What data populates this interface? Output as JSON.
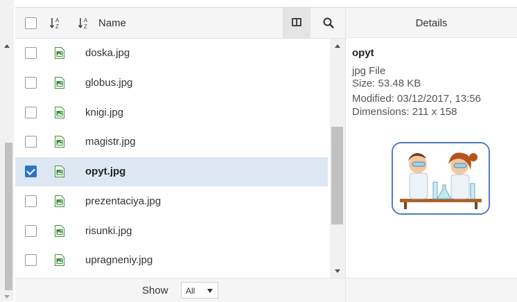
{
  "header": {
    "name_label": "Name",
    "details_label": "Details"
  },
  "files": [
    {
      "name": "doska.jpg",
      "selected": false
    },
    {
      "name": "globus.jpg",
      "selected": false
    },
    {
      "name": "knigi.jpg",
      "selected": false
    },
    {
      "name": "magistr.jpg",
      "selected": false
    },
    {
      "name": "opyt.jpg",
      "selected": true
    },
    {
      "name": "prezentaciya.jpg",
      "selected": false
    },
    {
      "name": "risunki.jpg",
      "selected": false
    },
    {
      "name": "upragneniy.jpg",
      "selected": false
    }
  ],
  "footer": {
    "show_label": "Show",
    "show_value": "All"
  },
  "details": {
    "name": "opyt",
    "type": "jpg File",
    "size": "Size: 53.48 KB",
    "modified": "Modified: 03/12/2017, 13:56",
    "dimensions": "Dimensions: 211 x 158"
  },
  "colors": {
    "selection": "#dde8f4",
    "checkbox_checked": "#2e74c5",
    "preview_border": "#4d79c7",
    "file_icon": "#3c8f3a"
  },
  "icons": [
    "sort-icon",
    "columns-icon",
    "search-icon",
    "image-file-icon"
  ]
}
